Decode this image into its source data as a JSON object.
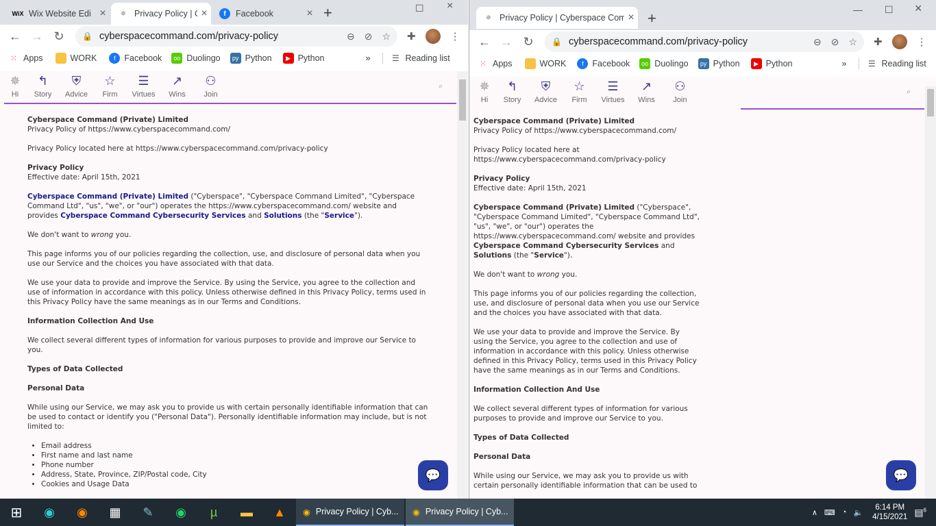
{
  "left": {
    "tabs": [
      {
        "title": "Wix Website Edi",
        "icon": "wix-icon"
      },
      {
        "title": "Privacy Policy | C",
        "icon": "cyberspace-icon"
      },
      {
        "title": "Facebook",
        "icon": "facebook-icon"
      }
    ],
    "url": "cyberspacecommand.com/privacy-policy"
  },
  "right": {
    "tabs": [
      {
        "title": "Privacy Policy | Cyberspace Comm",
        "icon": "cyberspace-icon"
      }
    ],
    "url": "cyberspacecommand.com/privacy-policy"
  },
  "bookmarks": {
    "apps": "Apps",
    "work": "WORK",
    "facebook": "Facebook",
    "duolingo": "Duolingo",
    "python1": "Python",
    "python2": "Python",
    "more": "»",
    "reading_list": "Reading list"
  },
  "sitenav": [
    "Hi",
    "Story",
    "Advice",
    "Firm",
    "Virtues",
    "Wins",
    "Join"
  ],
  "policy": {
    "company": "Cyberspace Command (Private) Limited",
    "of": "Privacy Policy of https://www.cyberspacecommand.com/",
    "located": "Privacy Policy located here at https://www.cyberspacecommand.com/privacy-policy",
    "pp_heading": "Privacy Policy",
    "effective": "Effective date: April 15th, 2021",
    "intro_company": "Cyberspace Command (Private) Limited",
    "intro_1": " (\"Cyberspace\", \"Cyberspace Command Limited\", \"Cyberspace Command Ltd\", \"us\", \"we\", or \"our\") operates the https://www.cyberspacecommand.com/ website and provides ",
    "intro_services": "Cyberspace Command Cybersecurity Services",
    "intro_2": " and ",
    "intro_solutions": "Solutions",
    "intro_3": " (the \"",
    "intro_service": "Service",
    "intro_4": "\").",
    "wrong_1": "We don't want to ",
    "wrong_em": "wrong",
    "wrong_2": " you.",
    "informs": "This page informs you of our policies regarding the collection, use, and disclosure of personal data when you use our Service and the choices you have associated with that data.",
    "we_use": "We use your data to provide and improve the Service. By using the Service, you agree to the collection and use of information in accordance with this policy. Unless otherwise defined in this Privacy Policy, terms used in this Privacy Policy have the same meanings as in our Terms and Conditions.",
    "info_heading": "Information Collection And Use",
    "collect": "We collect several different types of information for various purposes to provide and improve our Service to you.",
    "types_heading": "Types of Data Collected",
    "personal_heading": "Personal Data",
    "while_using": "While using our Service, we may ask you to provide us with certain personally identifiable information that can be used to contact or identify you (\"Personal Data\"). Personally identifiable information may include, but is not limited to:",
    "while_using_right": "While using our Service, we may ask you to provide us with certain personally identifiable information that can be used to",
    "list": [
      "Email address",
      "First name and last name",
      "Phone number",
      "Address, State, Province, ZIP/Postal code, City",
      "Cookies and Usage Data"
    ]
  },
  "taskbar": {
    "win1": "Privacy Policy | Cyb...",
    "win2": "Privacy Policy | Cyb...",
    "time": "6:14 PM",
    "date": "4/15/2021",
    "notif": "6"
  }
}
